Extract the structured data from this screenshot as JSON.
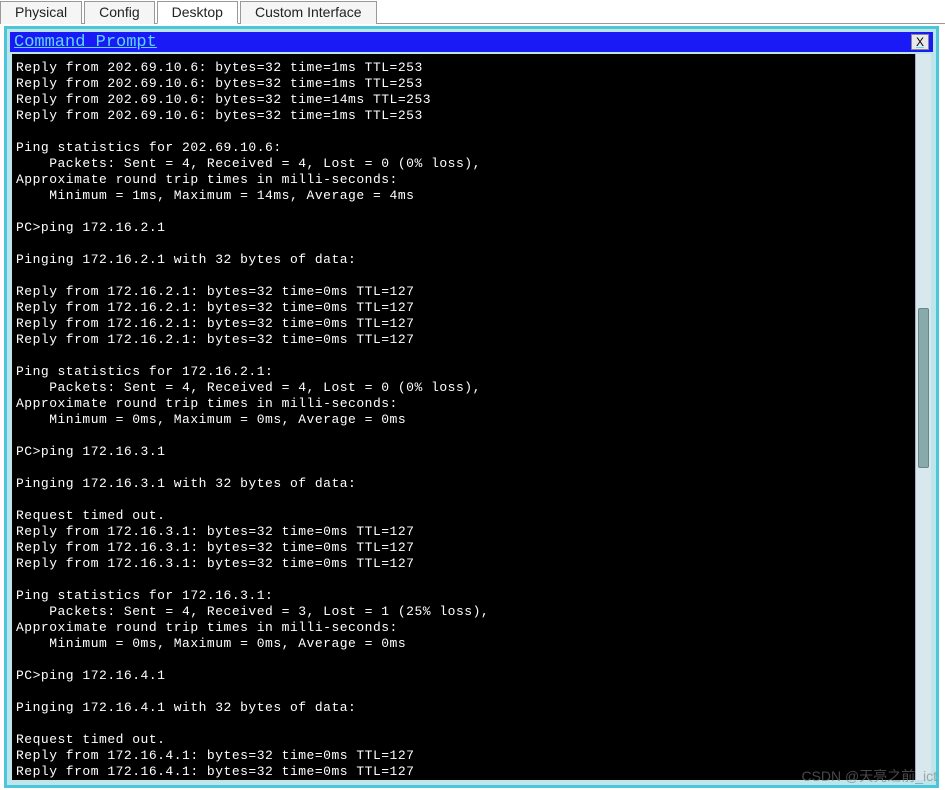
{
  "tabs": [
    {
      "label": "Physical"
    },
    {
      "label": "Config"
    },
    {
      "label": "Desktop"
    },
    {
      "label": "Custom Interface"
    }
  ],
  "window": {
    "title": "Command Prompt",
    "close_label": "X"
  },
  "terminal_lines": [
    "Reply from 202.69.10.6: bytes=32 time=1ms TTL=253",
    "Reply from 202.69.10.6: bytes=32 time=1ms TTL=253",
    "Reply from 202.69.10.6: bytes=32 time=14ms TTL=253",
    "Reply from 202.69.10.6: bytes=32 time=1ms TTL=253",
    "",
    "Ping statistics for 202.69.10.6:",
    "    Packets: Sent = 4, Received = 4, Lost = 0 (0% loss),",
    "Approximate round trip times in milli-seconds:",
    "    Minimum = 1ms, Maximum = 14ms, Average = 4ms",
    "",
    "PC>ping 172.16.2.1",
    "",
    "Pinging 172.16.2.1 with 32 bytes of data:",
    "",
    "Reply from 172.16.2.1: bytes=32 time=0ms TTL=127",
    "Reply from 172.16.2.1: bytes=32 time=0ms TTL=127",
    "Reply from 172.16.2.1: bytes=32 time=0ms TTL=127",
    "Reply from 172.16.2.1: bytes=32 time=0ms TTL=127",
    "",
    "Ping statistics for 172.16.2.1:",
    "    Packets: Sent = 4, Received = 4, Lost = 0 (0% loss),",
    "Approximate round trip times in milli-seconds:",
    "    Minimum = 0ms, Maximum = 0ms, Average = 0ms",
    "",
    "PC>ping 172.16.3.1",
    "",
    "Pinging 172.16.3.1 with 32 bytes of data:",
    "",
    "Request timed out.",
    "Reply from 172.16.3.1: bytes=32 time=0ms TTL=127",
    "Reply from 172.16.3.1: bytes=32 time=0ms TTL=127",
    "Reply from 172.16.3.1: bytes=32 time=0ms TTL=127",
    "",
    "Ping statistics for 172.16.3.1:",
    "    Packets: Sent = 4, Received = 3, Lost = 1 (25% loss),",
    "Approximate round trip times in milli-seconds:",
    "    Minimum = 0ms, Maximum = 0ms, Average = 0ms",
    "",
    "PC>ping 172.16.4.1",
    "",
    "Pinging 172.16.4.1 with 32 bytes of data:",
    "",
    "Request timed out.",
    "Reply from 172.16.4.1: bytes=32 time=0ms TTL=127",
    "Reply from 172.16.4.1: bytes=32 time=0ms TTL=127"
  ],
  "watermark": "CSDN @天亮之前_ict"
}
